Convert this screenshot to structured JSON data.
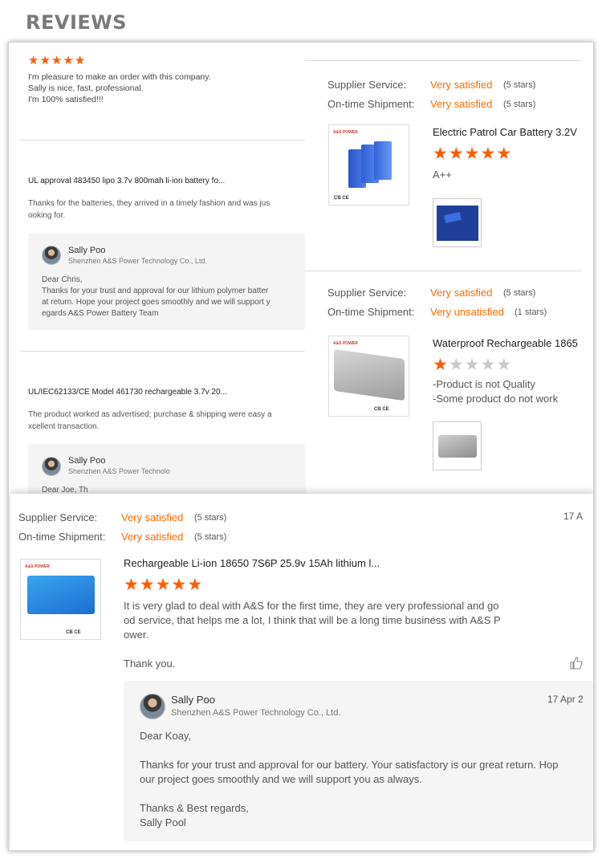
{
  "page": {
    "title": "REVIEWS"
  },
  "review1": {
    "rating": 5,
    "lines": [
      "I'm pleasure to make an order with this company.",
      "Sally is nice, fast, professional.",
      "I'm 100% satisfied!!!"
    ]
  },
  "review2": {
    "product": "UL approval 483450 lipo 3.7v 800mah li-ion battery fo...",
    "text_line1": "Thanks for the batteries, they arrived in a timely fashion and was jus",
    "text_line2": "ooking for.",
    "reply": {
      "name": "Sally Poo",
      "company": "Shenzhen A&S Power Technology Co., Ltd.",
      "greeting": "Dear Chris,",
      "line1": "Thanks for your trust and approval for our lithium polymer batter",
      "line2": "at return. Hope your project goes smoothly and we will support y",
      "line3": "egards A&S Power Battery Team"
    }
  },
  "review3": {
    "product": "UL/IEC62133/CE Model 461730 rechargeable 3.7v 20...",
    "text_line1": "The product worked as advertised; purchase & shipping were easy a",
    "text_line2": "xcellent transaction.",
    "reply": {
      "name": "Sally Poo",
      "company": "Shenzhen A&S Power Technolo",
      "greeting": "Dear Joe, Th"
    }
  },
  "card1": {
    "supplier_label": "Supplier Service:",
    "supplier_value": "Very satisfied",
    "supplier_count": "(5 stars)",
    "shipment_label": "On-time Shipment:",
    "shipment_value": "Very satisfied",
    "shipment_count": "(5 stars)",
    "product_title": "Electric Patrol Car Battery 3.2V",
    "rating": 5,
    "review_text": "A++",
    "brand_logo": "A&S POWER",
    "cert_marks": "CB CE"
  },
  "card2": {
    "supplier_label": "Supplier Service:",
    "supplier_value": "Very satisfied",
    "supplier_count": "(5 stars)",
    "shipment_label": "On-time Shipment:",
    "shipment_value": "Very unsatisfied",
    "shipment_count": "(1 stars)",
    "product_title": "Waterproof Rechargeable 1865",
    "rating": 1,
    "review_line1": "-Product is not Quality",
    "review_line2": "-Some product do not work",
    "brand_logo": "A&S POWER",
    "cert_marks": "CB CE"
  },
  "card3": {
    "supplier_label": "Supplier Service:",
    "supplier_value": "Very satisfied",
    "supplier_count": "(5 stars)",
    "shipment_label": "On-time Shipment:",
    "shipment_value": "Very satisfied",
    "shipment_count": "(5 stars)",
    "date": "17 A",
    "product_title": "Rechargeable Li-ion 18650 7S6P 25.9v 15Ah lithium l...",
    "rating": 5,
    "text_line1": "It is very glad to deal with A&S for the first time, they are very professional and go",
    "text_line2": "od service, that helps me a lot, I think that will be a long time business with A&S P",
    "text_line3": "ower.",
    "thanks": "Thank you.",
    "brand_logo": "A&S POWER",
    "cert_marks": "CB CE",
    "reply": {
      "name": "Sally Poo",
      "company": "Shenzhen A&S Power Technology Co., Ltd.",
      "date": "17 Apr 2",
      "greeting": "Dear Koay,",
      "line1": "Thanks for your trust and approval for our battery. Your satisfactory is our great return. Hop",
      "line2": "our project goes smoothly and we will support you as always.",
      "sign1": "Thanks & Best regards,",
      "sign2": "Sally Pool"
    }
  },
  "colors": {
    "accent": "#ff6a00",
    "star_off": "#c8c8c8"
  },
  "icons": {
    "like": "thumbs-up-icon"
  }
}
